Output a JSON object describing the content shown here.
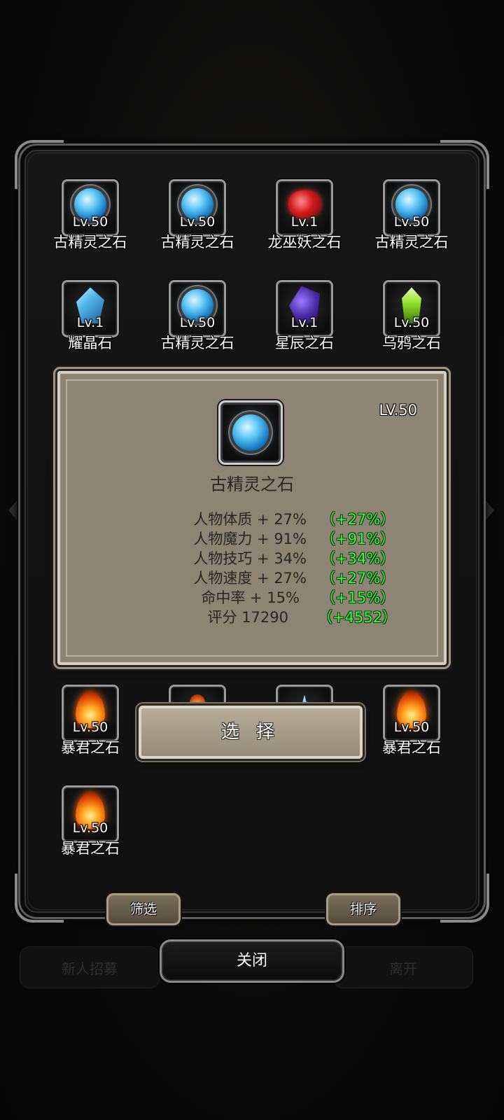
{
  "background": {
    "left_button": "新人招募",
    "right_button": "离开",
    "title": "关闭"
  },
  "grid": {
    "items": [
      {
        "level": "Lv.50",
        "name": "古精灵之石",
        "icon": "ancient-elf-stone-icon"
      },
      {
        "level": "Lv.50",
        "name": "古精灵之石",
        "icon": "ancient-elf-stone-icon"
      },
      {
        "level": "Lv.1",
        "name": "龙巫妖之石",
        "icon": "dragon-lich-stone-icon"
      },
      {
        "level": "Lv.50",
        "name": "古精灵之石",
        "icon": "ancient-elf-stone-icon"
      },
      {
        "level": "Lv.1",
        "name": "耀晶石",
        "icon": "shining-crystal-icon"
      },
      {
        "level": "Lv.50",
        "name": "古精灵之石",
        "icon": "ancient-elf-stone-icon"
      },
      {
        "level": "Lv.1",
        "name": "星辰之石",
        "icon": "star-stone-icon"
      },
      {
        "level": "Lv.50",
        "name": "乌鸦之石",
        "icon": "crow-stone-icon"
      },
      {
        "level": "Lv.50",
        "name": "暴君之石",
        "icon": "tyrant-stone-icon"
      },
      {
        "level": "Lv.50",
        "name": "暴君之石",
        "icon": "tyrant-stone-icon"
      },
      {
        "level": "Lv.50",
        "name": "暴君之石",
        "icon": "tyrant-stone-icon"
      }
    ]
  },
  "detail": {
    "level": "LV.50",
    "name": "古精灵之石",
    "stats": [
      {
        "label": "人物体质 + 27%",
        "bonus": "（+27%）"
      },
      {
        "label": "人物魔力 + 91%",
        "bonus": "（+91%）"
      },
      {
        "label": "人物技巧 + 34%",
        "bonus": "（+34%）"
      },
      {
        "label": "人物速度 + 27%",
        "bonus": "（+27%）"
      },
      {
        "label": "命中率 + 15%",
        "bonus": "（+15%）"
      },
      {
        "label": "评分 17290",
        "bonus": "（+4552）"
      }
    ]
  },
  "buttons": {
    "select": "选 择",
    "filter": "筛选",
    "sort": "排序",
    "close": "关闭"
  },
  "colors": {
    "bonus_green": "#39ff3a",
    "detail_bg": "#8d8474"
  }
}
